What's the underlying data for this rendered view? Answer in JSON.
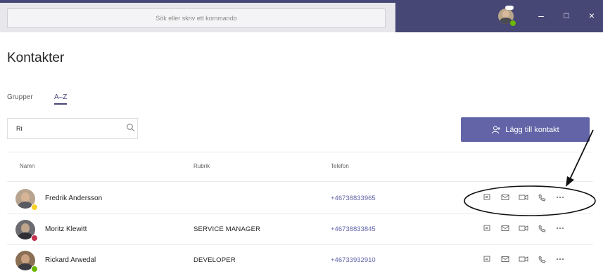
{
  "titlebar": {
    "search_placeholder": "Sök eller skriv ett kommando",
    "minimize": "–",
    "maximize": "□",
    "close": "×"
  },
  "page": {
    "title": "Kontakter"
  },
  "tabs": [
    {
      "label": "Grupper",
      "active": false
    },
    {
      "label": "A–Z",
      "active": true
    }
  ],
  "filter": {
    "value": "Ri"
  },
  "add_contact": {
    "label": "Lägg till kontakt"
  },
  "columns": {
    "name": "Namn",
    "role": "Rubrik",
    "phone": "Telefon"
  },
  "contacts": [
    {
      "name": "Fredrik Andersson",
      "role": "",
      "phone": "+46738833965",
      "status_color": "#f8d22a"
    },
    {
      "name": "Moritz Klewitt",
      "role": "SERVICE MANAGER",
      "phone": "+46738833845",
      "status_color": "#c4314b"
    },
    {
      "name": "Rickard Arwedal",
      "role": "DEVELOPER",
      "phone": "+46733932910",
      "status_color": "#6bb700"
    }
  ],
  "colors": {
    "titlebar": "#464775",
    "accent": "#6264a7",
    "annotation": "#111111"
  }
}
